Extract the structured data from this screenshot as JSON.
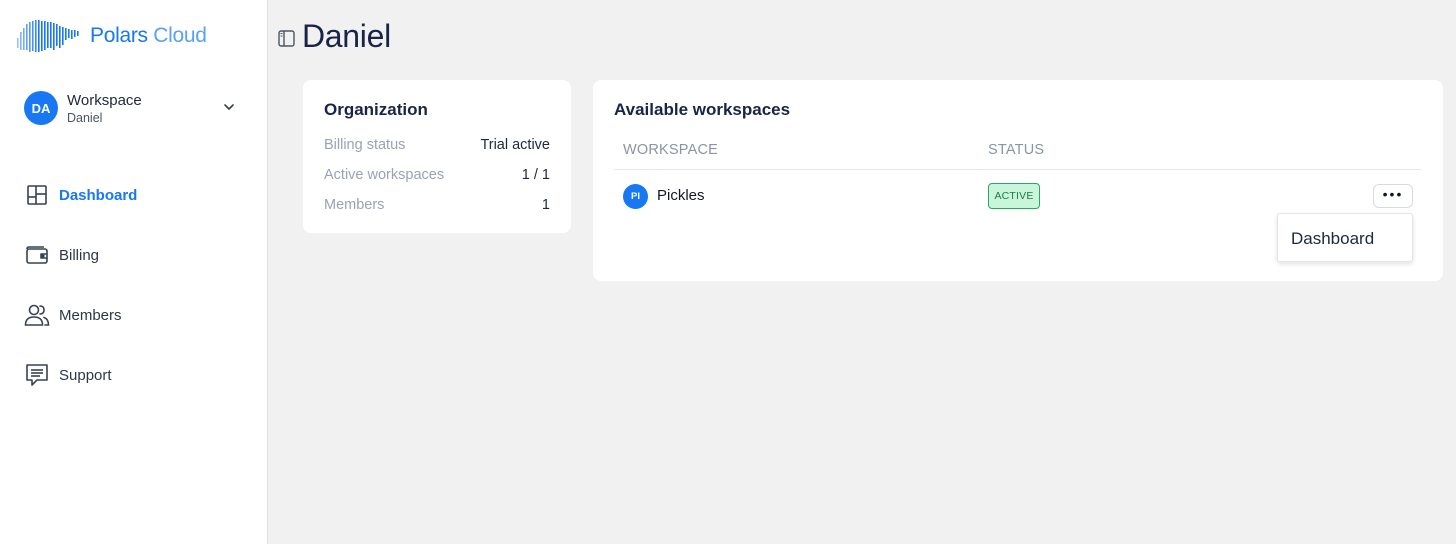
{
  "app": {
    "brand_primary": "Polars",
    "brand_secondary": "Cloud",
    "accent_color": "#1877f2"
  },
  "workspace_switcher": {
    "avatar_initials": "DA",
    "label": "Workspace",
    "subtitle": "Daniel"
  },
  "nav": {
    "items": [
      {
        "label": "Dashboard",
        "icon": "dashboard-icon",
        "active": true
      },
      {
        "label": "Billing",
        "icon": "wallet-icon",
        "active": false
      },
      {
        "label": "Members",
        "icon": "users-icon",
        "active": false
      },
      {
        "label": "Support",
        "icon": "chat-icon",
        "active": false
      }
    ]
  },
  "header": {
    "title": "Daniel"
  },
  "organization": {
    "title": "Organization",
    "rows": [
      {
        "label": "Billing status",
        "value": "Trial active"
      },
      {
        "label": "Active workspaces",
        "value": "1 / 1"
      },
      {
        "label": "Members",
        "value": "1"
      }
    ]
  },
  "workspaces": {
    "title": "Available workspaces",
    "columns": [
      "WORKSPACE",
      "STATUS"
    ],
    "rows": [
      {
        "avatar_initials": "PI",
        "name": "Pickles",
        "status": "ACTIVE",
        "status_color": "#1e7a49"
      }
    ]
  },
  "row_menu": {
    "items": [
      "Dashboard"
    ]
  }
}
